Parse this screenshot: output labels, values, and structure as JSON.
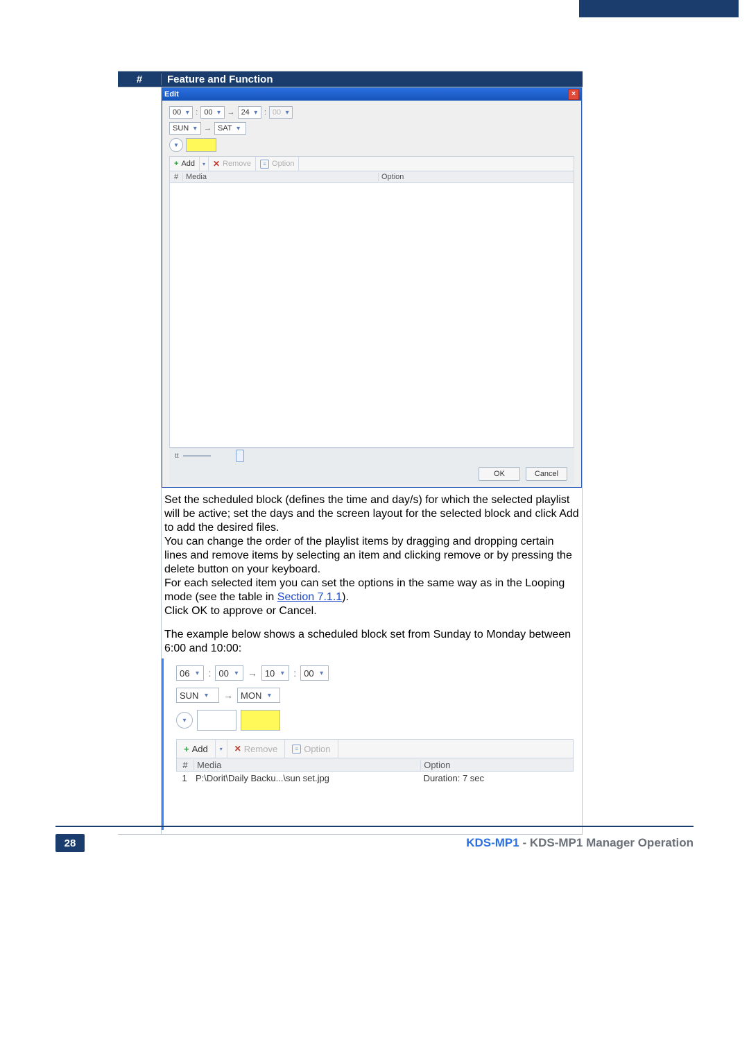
{
  "table": {
    "headers": {
      "num": "#",
      "feat": "Feature and Function"
    }
  },
  "dialog1": {
    "title": "Edit",
    "time": {
      "h1": "00",
      "m1": "00",
      "h2": "24",
      "m2": "00"
    },
    "days": {
      "from": "SUN",
      "to": "SAT"
    },
    "toolbar": {
      "add": "Add",
      "remove": "Remove",
      "option": "Option"
    },
    "grid": {
      "num": "#",
      "media": "Media",
      "option": "Option"
    },
    "buttons": {
      "ok": "OK",
      "cancel": "Cancel"
    }
  },
  "description": {
    "p1": "Set the scheduled block (defines the time and day/s) for which the selected playlist will be active; set the days and the screen layout for the selected block and click Add to add the desired files.",
    "p2": "You can change the order of the playlist items by dragging and dropping certain lines and remove items by selecting an item and clicking remove or by pressing the delete button on your keyboard.",
    "p3a": "For each selected item you can set the options in the same way as in the Looping mode (see the table in ",
    "p3link": "Section 7.1.1",
    "p3b": ").",
    "p4": "Click OK to approve or Cancel.",
    "p5": "The example below shows a scheduled block set from Sunday to Monday between 6:00 and 10:00:"
  },
  "dialog2": {
    "time": {
      "h1": "06",
      "m1": "00",
      "h2": "10",
      "m2": "00"
    },
    "days": {
      "from": "SUN",
      "to": "MON"
    },
    "toolbar": {
      "add": "Add",
      "remove": "Remove",
      "option": "Option"
    },
    "grid": {
      "num": "#",
      "media": "Media",
      "option": "Option"
    },
    "row1": {
      "idx": "1",
      "media": "P:\\Dorit\\Daily Backu...\\sun set.jpg",
      "option": "Duration: 7 sec"
    }
  },
  "footer": {
    "page": "28",
    "text_a": "KDS-MP1",
    "text_b": " - KDS-MP1 Manager Operation"
  }
}
